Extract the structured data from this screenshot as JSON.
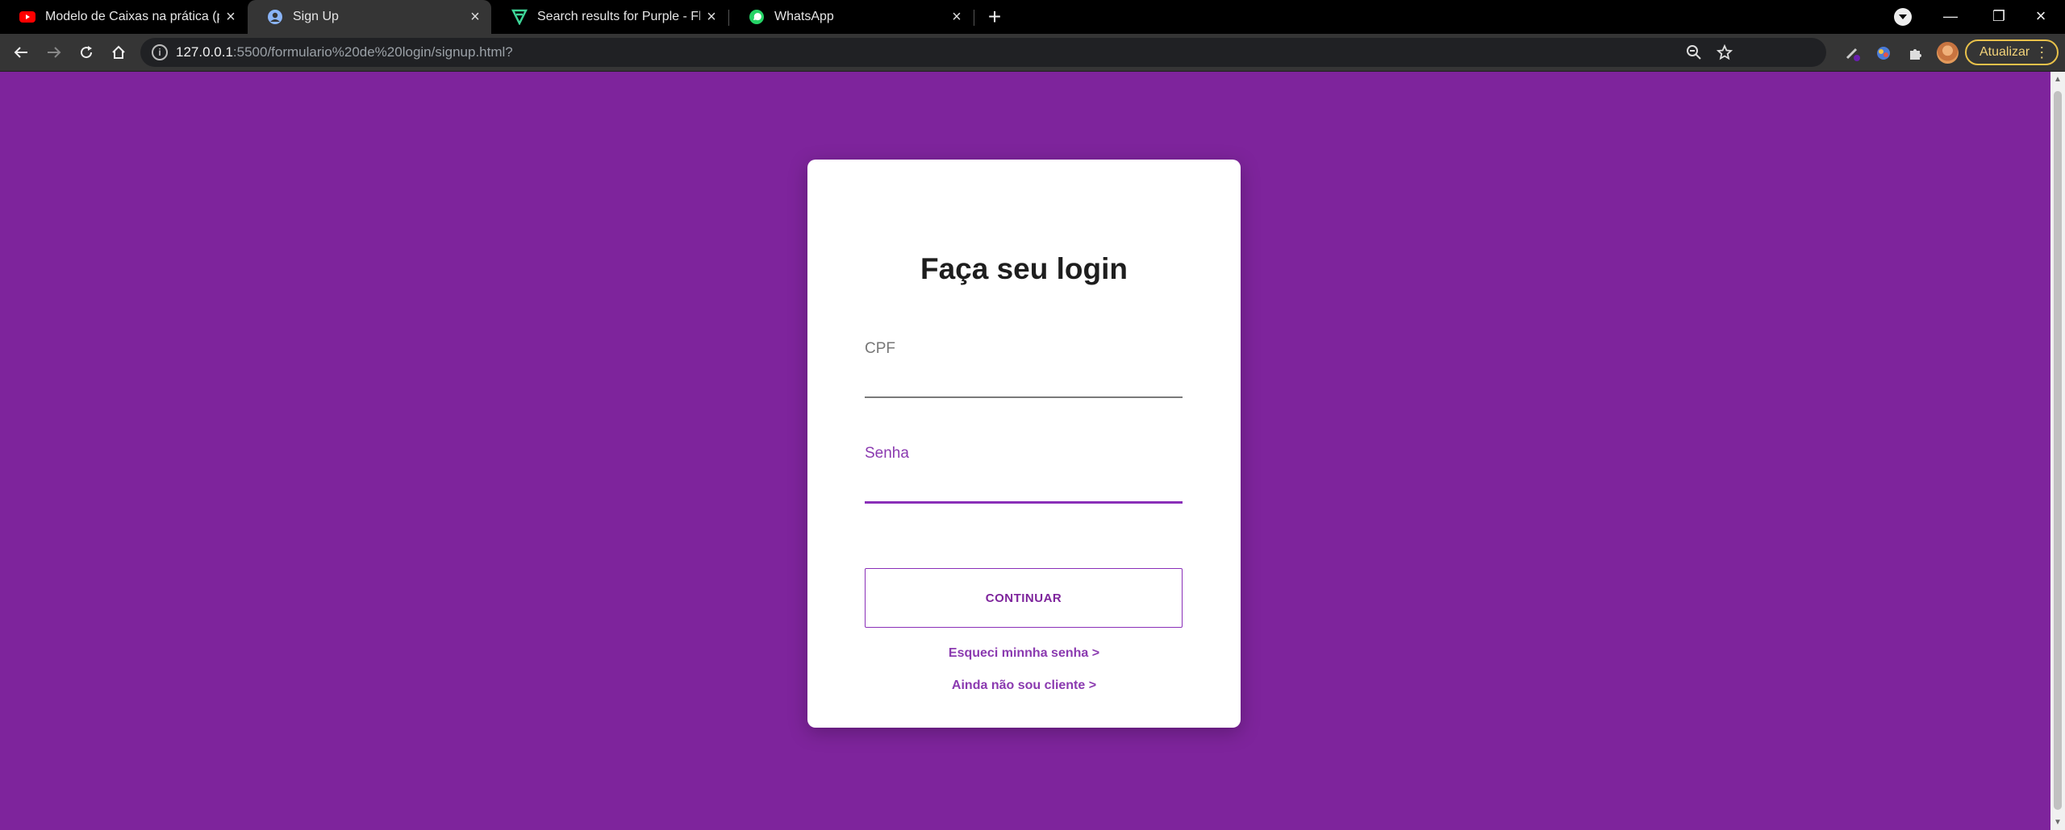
{
  "browser": {
    "tabs": [
      {
        "title": "Modelo de Caixas na prática (par",
        "icon": "youtube-icon",
        "active": false
      },
      {
        "title": "Sign Up",
        "icon": "globe-icon",
        "active": true
      },
      {
        "title": "Search results for Purple - Flatico",
        "icon": "flaticon-icon",
        "active": false
      },
      {
        "title": "WhatsApp",
        "icon": "whatsapp-icon",
        "active": false
      }
    ],
    "url_host": "127.0.0.1",
    "url_rest": ":5500/formulario%20de%20login/signup.html?",
    "update_label": "Atualizar"
  },
  "page": {
    "background": "#7e249c",
    "title": "Faça seu login",
    "cpf_label": "CPF",
    "senha_label": "Senha",
    "continue_label": "CONTINUAR",
    "forgot_link": "Esqueci minnha senha >",
    "signup_link": "Ainda não sou cliente >"
  },
  "colors": {
    "accent": "#8a2fb8",
    "tab_active": "#353535"
  }
}
